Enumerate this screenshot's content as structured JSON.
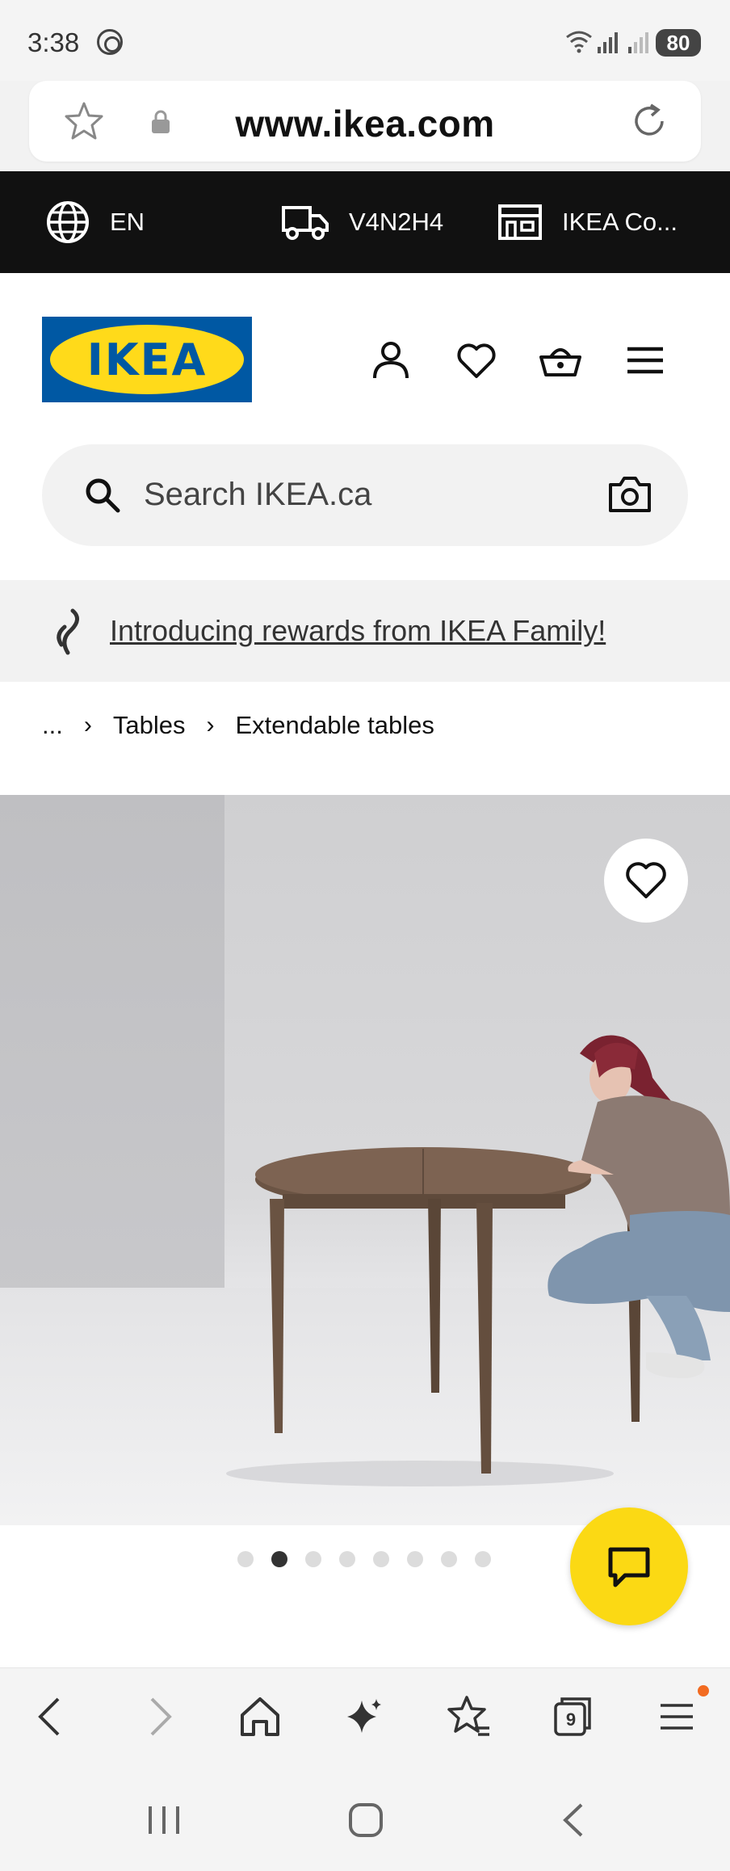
{
  "status_bar": {
    "time": "3:38",
    "battery": "80"
  },
  "browser": {
    "url": "www.ikea.com",
    "tab_count": "9"
  },
  "top_bar": {
    "language": "EN",
    "postal_code": "V4N2H4",
    "store": "IKEA Co..."
  },
  "header": {
    "logo_text": "IKEA",
    "search_placeholder": "Search IKEA.ca"
  },
  "banner": {
    "text": "Introducing rewards from IKEA Family!"
  },
  "breadcrumb": {
    "items": [
      "...",
      "Tables",
      "Extendable tables"
    ]
  },
  "gallery": {
    "dot_count": 8,
    "active_index": 1
  },
  "colors": {
    "ikea_blue": "#0058a3",
    "ikea_yellow": "#ffda1a",
    "chat_yellow": "#fbd914",
    "topbar_bg": "#111111",
    "notification_dot": "#f26b21"
  }
}
